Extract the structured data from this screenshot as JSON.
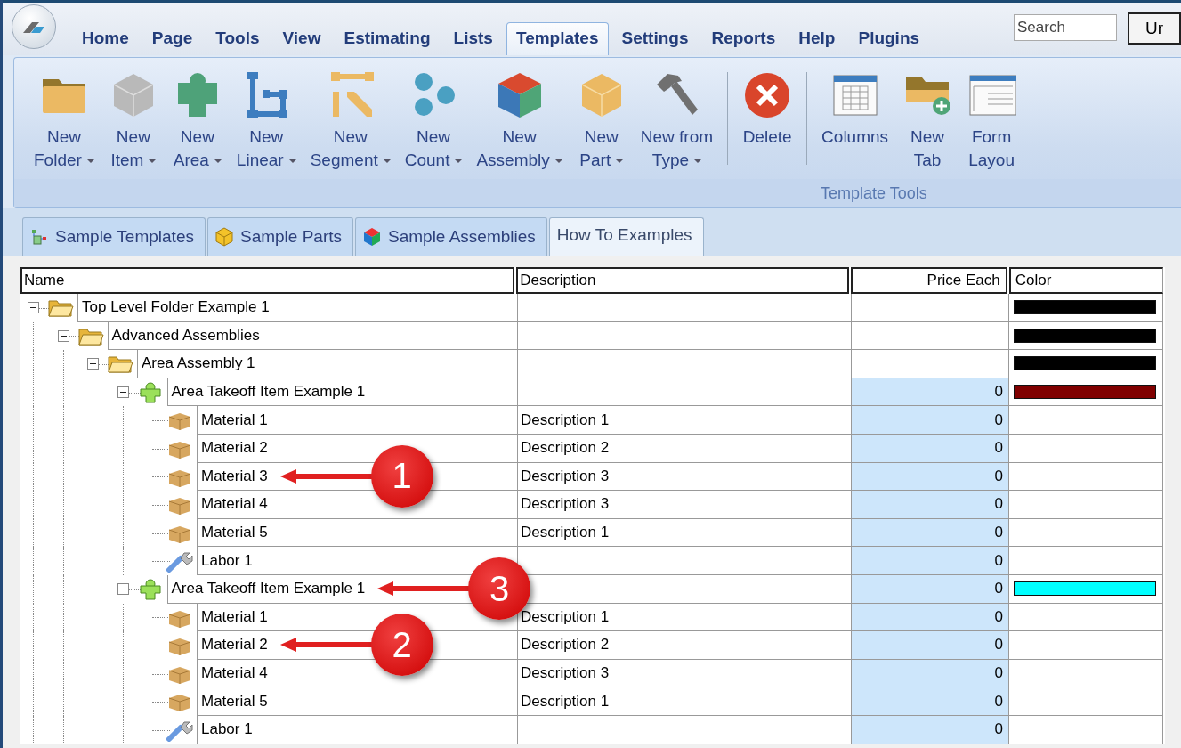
{
  "menu_tabs": [
    {
      "label": "Home",
      "selected": false
    },
    {
      "label": "Page",
      "selected": false
    },
    {
      "label": "Tools",
      "selected": false
    },
    {
      "label": "View",
      "selected": false
    },
    {
      "label": "Estimating",
      "selected": false
    },
    {
      "label": "Lists",
      "selected": false
    },
    {
      "label": "Templates",
      "selected": true
    },
    {
      "label": "Settings",
      "selected": false
    },
    {
      "label": "Reports",
      "selected": false
    },
    {
      "label": "Help",
      "selected": false
    },
    {
      "label": "Plugins",
      "selected": false
    }
  ],
  "search": {
    "placeholder": "Search"
  },
  "cut_button": "Ur",
  "ribbon": {
    "sections": [
      {
        "buttons": [
          {
            "kind": "folder",
            "lines": [
              "New",
              "Folder"
            ],
            "dropdown": true
          },
          {
            "kind": "item",
            "lines": [
              "New",
              "Item"
            ],
            "dropdown": true
          },
          {
            "kind": "area",
            "lines": [
              "New",
              "Area"
            ],
            "dropdown": true
          },
          {
            "kind": "linear",
            "lines": [
              "New",
              "Linear"
            ],
            "dropdown": true
          },
          {
            "kind": "segment",
            "lines": [
              "New",
              "Segment"
            ],
            "dropdown": true
          },
          {
            "kind": "count",
            "lines": [
              "New",
              "Count"
            ],
            "dropdown": true
          },
          {
            "kind": "assembly",
            "lines": [
              "New",
              "Assembly"
            ],
            "dropdown": true
          },
          {
            "kind": "part",
            "lines": [
              "New",
              "Part"
            ],
            "dropdown": true
          },
          {
            "kind": "type",
            "lines": [
              "New from",
              "Type"
            ],
            "dropdown": true
          }
        ]
      },
      {
        "buttons": [
          {
            "kind": "delete",
            "lines": [
              "Delete"
            ],
            "dropdown": false
          }
        ]
      },
      {
        "buttons": [
          {
            "kind": "columns",
            "lines": [
              "Columns"
            ],
            "dropdown": false
          },
          {
            "kind": "tab",
            "lines": [
              "New",
              "Tab"
            ],
            "dropdown": false
          },
          {
            "kind": "layout",
            "lines": [
              "Form",
              "Layou"
            ],
            "dropdown": false
          }
        ]
      }
    ],
    "group_label": "Template Tools"
  },
  "doc_tabs": [
    {
      "label": "Sample Templates",
      "kind": "templates",
      "selected": false
    },
    {
      "label": "Sample Parts",
      "kind": "parts",
      "selected": false
    },
    {
      "label": "Sample Assemblies",
      "kind": "assemblies",
      "selected": false
    },
    {
      "label": "How To Examples",
      "kind": "plain",
      "selected": true
    }
  ],
  "grid": {
    "columns": [
      "Name",
      "Description",
      "Price Each",
      "Color"
    ],
    "rows": [
      {
        "kind": "folder",
        "name": "Top Level Folder Example 1",
        "color": "#000000",
        "expanded": true,
        "children": [
          {
            "kind": "folder",
            "name": "Advanced Assemblies",
            "color": "#000000",
            "expanded": true,
            "children": [
              {
                "kind": "folder",
                "name": "Area Assembly 1",
                "color": "#000000",
                "expanded": true,
                "children": [
                  {
                    "kind": "area",
                    "name": "Area Takeoff Item Example 1",
                    "price": "0",
                    "color": "#800000",
                    "expanded": true,
                    "children": [
                      {
                        "kind": "material",
                        "name": "Material 1",
                        "description": "Description 1",
                        "price": "0"
                      },
                      {
                        "kind": "material",
                        "name": "Material 2",
                        "description": "Description 2",
                        "price": "0"
                      },
                      {
                        "kind": "material",
                        "name": "Material 3",
                        "description": "Description 3",
                        "price": "0",
                        "callout": "1"
                      },
                      {
                        "kind": "material",
                        "name": "Material 4",
                        "description": "Description 3",
                        "price": "0"
                      },
                      {
                        "kind": "material",
                        "name": "Material 5",
                        "description": "Description 1",
                        "price": "0"
                      },
                      {
                        "kind": "labor",
                        "name": "Labor 1",
                        "price": "0"
                      }
                    ]
                  },
                  {
                    "kind": "area",
                    "name": "Area Takeoff Item Example 1",
                    "price": "0",
                    "color": "#00ffff",
                    "expanded": true,
                    "callout": "3",
                    "children": [
                      {
                        "kind": "material",
                        "name": "Material 1",
                        "description": "Description 1",
                        "price": "0"
                      },
                      {
                        "kind": "material",
                        "name": "Material 2",
                        "description": "Description 2",
                        "price": "0",
                        "callout": "2"
                      },
                      {
                        "kind": "material",
                        "name": "Material 4",
                        "description": "Description 3",
                        "price": "0"
                      },
                      {
                        "kind": "material",
                        "name": "Material 5",
                        "description": "Description 1",
                        "price": "0"
                      },
                      {
                        "kind": "labor",
                        "name": "Labor 1",
                        "price": "0"
                      }
                    ]
                  }
                ]
              }
            ]
          }
        ]
      }
    ]
  }
}
